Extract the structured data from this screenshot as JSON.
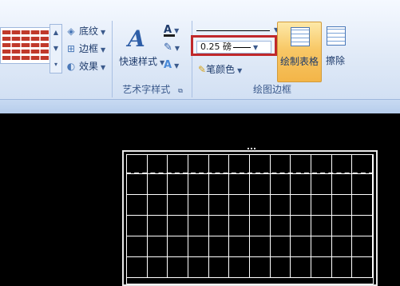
{
  "ribbon": {
    "table_styles": {
      "shading_label": "底纹",
      "borders_label": "边框",
      "effects_label": "效果"
    },
    "wordart_styles": {
      "quick_styles_label": "快速样式",
      "group_label": "艺术字样式",
      "text_fill_glyph": "A",
      "text_effects_glyph": "A"
    },
    "draw_borders": {
      "pen_weight_value": "0.25 磅",
      "pen_color_label": "笔颜色",
      "draw_table_label": "绘制表格",
      "eraser_label": "擦除",
      "group_label": "绘图边框"
    }
  },
  "colors": {
    "highlight_box": "#c0282a",
    "text_fill_underline": "#1e1e1e",
    "pen_underline": "#d4a21a",
    "active_button": "#f8c867",
    "document_bg": "#000000"
  }
}
